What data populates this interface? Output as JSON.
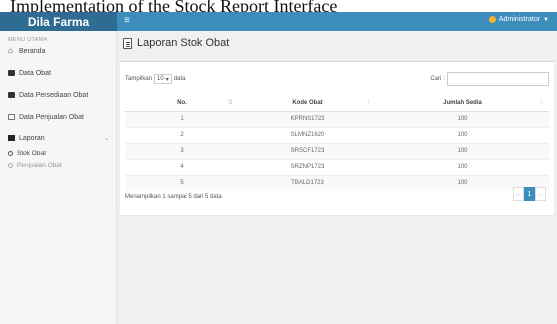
{
  "caption": "Implementation of the Stock Report Interface",
  "app": {
    "brand": "Dila Farma",
    "menu_icon": "hamburger-icon"
  },
  "navbar": {
    "user_name": "Administrator",
    "user_icon": "user-avatar-icon"
  },
  "sidebar": {
    "header": "MENU UTAMA",
    "items": [
      {
        "label": "Beranda",
        "icon": "home-icon"
      },
      {
        "label": "Data Obat",
        "icon": "box-icon"
      },
      {
        "label": "Data Persediaan Obat",
        "icon": "box-icon"
      },
      {
        "label": "Data Penjualan Obat",
        "icon": "document-icon"
      },
      {
        "label": "Laporan",
        "icon": "book-icon"
      }
    ],
    "sub_items": [
      {
        "label": "Stok Obat"
      },
      {
        "label": "Penjualan Obat"
      }
    ]
  },
  "page": {
    "title": "Laporan Stok Obat",
    "title_icon": "report-icon"
  },
  "table_controls": {
    "show_label": "Tampilkan",
    "page_size": "10",
    "entries_label": "data",
    "search_label": "Cari",
    "search_value": ""
  },
  "table": {
    "columns": [
      "No.",
      "Kode Obat",
      "Jumlah Sedia"
    ],
    "rows": [
      [
        "1",
        "KPRNS1723",
        "100"
      ],
      [
        "2",
        "SLMNZ1620",
        "100"
      ],
      [
        "3",
        "SRSCF1723",
        "100"
      ],
      [
        "4",
        "SRZNP1723",
        "100"
      ],
      [
        "5",
        "TBALD1723",
        "100"
      ]
    ]
  },
  "footer": {
    "info": "Menampilkan 1 sampai 5 dari 5 data",
    "pages": [
      "←",
      "1",
      "→"
    ]
  },
  "colors": {
    "brand_bg": "#2e6c94",
    "navbar_bg": "#3c8dbc",
    "sidebar_bg": "#f6f6f6",
    "content_bg": "#f0f0f2",
    "active_page": "#3c8dbc"
  }
}
